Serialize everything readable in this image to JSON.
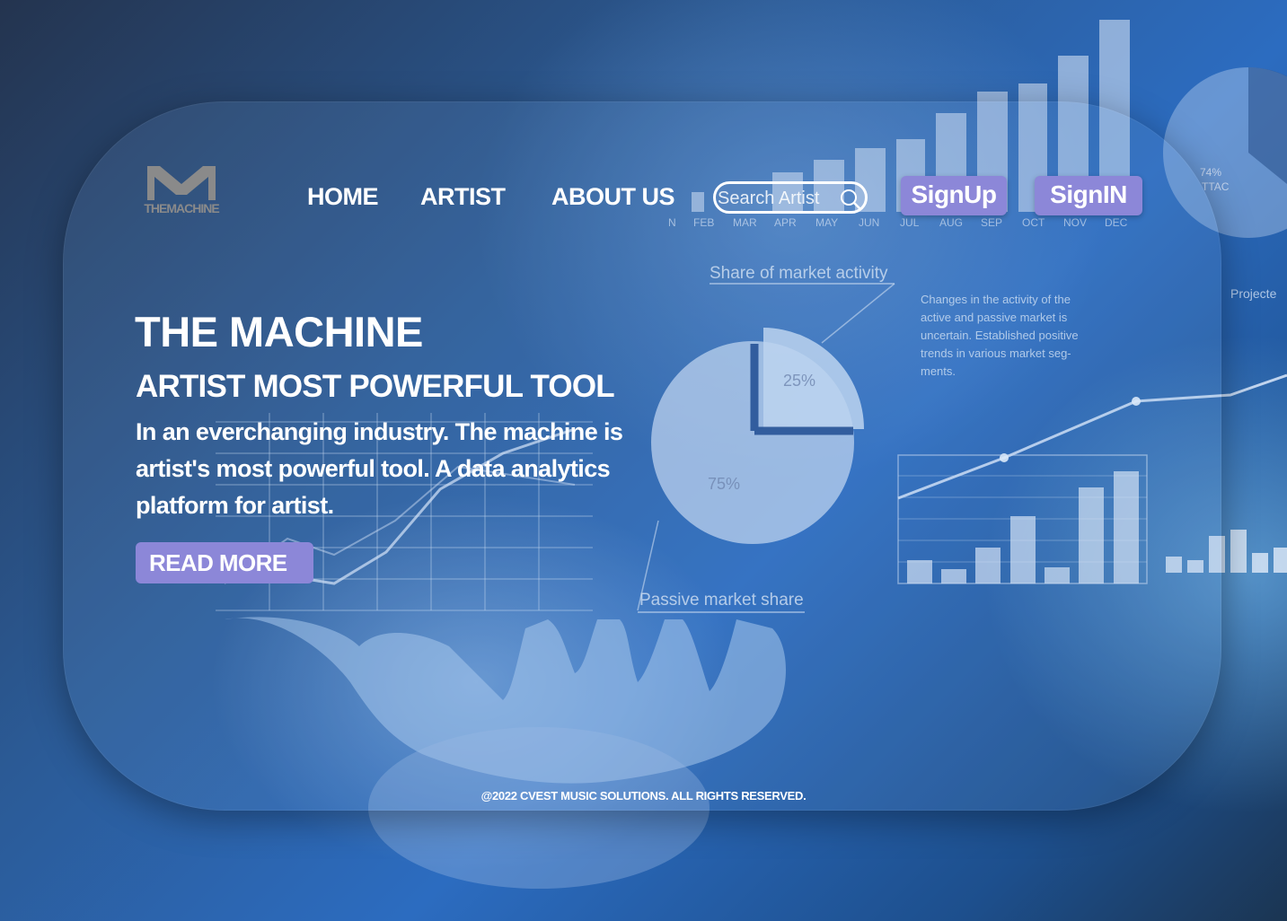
{
  "brand": {
    "logo_text": "THEMACHINE"
  },
  "nav": {
    "items": [
      {
        "label": "HOME"
      },
      {
        "label": "ARTIST"
      },
      {
        "label": "ABOUT US"
      }
    ]
  },
  "search": {
    "placeholder": "Search Artist",
    "icon": "search-icon"
  },
  "auth": {
    "signup_label": "SignUp",
    "signin_label": "SignIN"
  },
  "hero": {
    "title": "THE MACHINE",
    "subtitle": "ARTIST MOST POWERFUL TOOL",
    "description": "In an everchanging industry. The machine is artist's most powerful tool. A data analytics platform for artist.",
    "cta_label": "READ MORE"
  },
  "background_graphic": {
    "month_labels": [
      "N",
      "FEB",
      "MAR",
      "APR",
      "MAY",
      "JUN",
      "JUL",
      "AUG",
      "SEP",
      "OCT",
      "NOV",
      "DEC"
    ],
    "pie_title": "Share of market activity",
    "pie_labels": [
      "25%",
      "75%"
    ],
    "pie_caption": "Passive market share",
    "note": "Changes in the activity of the active and passive market is uncertain. Established positive trends in various market seg-ments.",
    "side_label": "Projecte",
    "side_pie_labels": [
      "74%",
      "TTAC"
    ]
  },
  "footer": {
    "copyright": "@2022 CVEST MUSIC SOLUTIONS. ALL RIGHTS RESERVED."
  },
  "colors": {
    "accent": "#8c87d8",
    "text": "#ffffff",
    "logo": "#8a8a8a",
    "bg_dark": "#1b3552",
    "bg_mid": "#2c6cc0"
  }
}
